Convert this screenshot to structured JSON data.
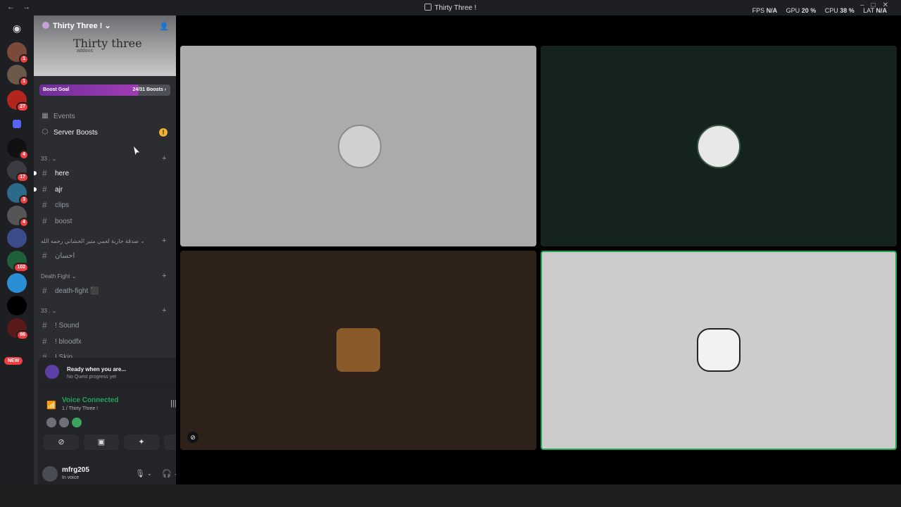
{
  "titlebar": {
    "title": "Thirty Three !",
    "fps_label": "FPS",
    "fps_value": "N/A",
    "gpu_label": "GPU",
    "gpu_value": "20 %",
    "cpu_label": "CPU",
    "cpu_value": "38 %",
    "lat_label": "LAT",
    "lat_value": "N/A"
  },
  "servers": [
    {
      "badge": "1"
    },
    {
      "badge": "1"
    },
    {
      "badge": "27"
    },
    {
      "badge": ""
    },
    {
      "badge": "4"
    },
    {
      "badge": "17"
    },
    {
      "badge": "3"
    },
    {
      "badge": "4"
    },
    {
      "badge": ""
    },
    {
      "badge": "102"
    },
    {
      "badge": ""
    },
    {
      "badge": ""
    },
    {
      "badge": "86"
    }
  ],
  "new_pill": "NEW",
  "sidebar": {
    "server_name": "Thirty Three !",
    "banner_title": "Thirty three",
    "banner_sub": "addons",
    "boost_goal": "Boost Goal",
    "boost_count": "24/31 Boosts",
    "events": "Events",
    "server_boosts": "Server Boosts",
    "categories": [
      {
        "name": "33 .",
        "channels": [
          "here",
          "ajr",
          "clips",
          "boost"
        ]
      },
      {
        "name": "صدقة جارية لعمي متير الحشاني رحمه الله",
        "channels": [
          "احسان"
        ]
      },
      {
        "name": "Death Fight",
        "channels": [
          "death-fight ⬛"
        ]
      },
      {
        "name": "33 .",
        "channels": [
          "! Sound",
          "! bloodfx",
          "! Skin"
        ]
      }
    ]
  },
  "quest": {
    "title": "Ready when you are...",
    "sub": "No Quest progress yet"
  },
  "voice": {
    "status": "Voice Connected",
    "channel": "1 / Thirty Three !"
  },
  "user": {
    "name": "mfrg205",
    "status": "In voice"
  },
  "tiles_colors": [
    "#a9abad",
    "#14231e",
    "#2e2119",
    "#cccccc"
  ]
}
